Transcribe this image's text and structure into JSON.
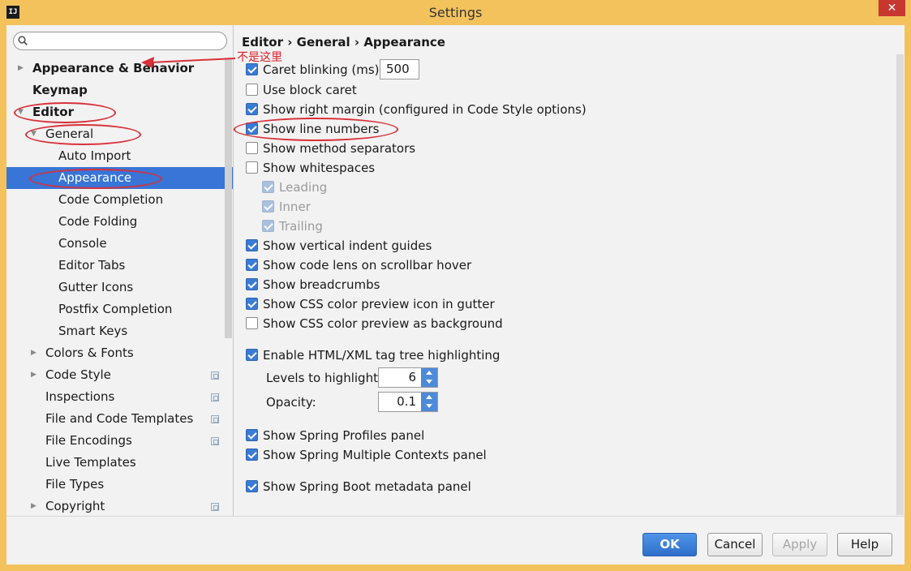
{
  "window": {
    "title": "Settings",
    "app_icon": "IJ",
    "close_label": "✕"
  },
  "search": {
    "placeholder": ""
  },
  "tree": [
    {
      "label": "Appearance & Behavior",
      "bold": true,
      "arrow": "right"
    },
    {
      "label": "Keymap",
      "bold": true
    },
    {
      "label": "Editor",
      "bold": true,
      "arrow": "down"
    },
    {
      "label": "General",
      "arrow": "down"
    },
    {
      "label": "Auto Import"
    },
    {
      "label": "Appearance",
      "selected": true
    },
    {
      "label": "Code Completion"
    },
    {
      "label": "Code Folding"
    },
    {
      "label": "Console"
    },
    {
      "label": "Editor Tabs"
    },
    {
      "label": "Gutter Icons"
    },
    {
      "label": "Postfix Completion"
    },
    {
      "label": "Smart Keys"
    },
    {
      "label": "Colors & Fonts",
      "arrow": "right"
    },
    {
      "label": "Code Style",
      "arrow": "right",
      "copy": true
    },
    {
      "label": "Inspections",
      "copy": true
    },
    {
      "label": "File and Code Templates",
      "copy": true
    },
    {
      "label": "File Encodings",
      "copy": true
    },
    {
      "label": "Live Templates"
    },
    {
      "label": "File Types"
    },
    {
      "label": "Copyright",
      "arrow": "right",
      "copy": true
    }
  ],
  "breadcrumb": {
    "part1": "Editor",
    "sep": "›",
    "part2": "General",
    "part3": "Appearance"
  },
  "options": {
    "caret_blinking": {
      "label": "Caret blinking (ms):",
      "checked": true,
      "value": "500"
    },
    "block_caret": {
      "label": "Use block caret",
      "checked": false
    },
    "right_margin": {
      "label": "Show right margin (configured in Code Style options)",
      "checked": true
    },
    "line_numbers": {
      "label": "Show line numbers",
      "checked": true
    },
    "method_separators": {
      "label": "Show method separators",
      "checked": false
    },
    "whitespaces": {
      "label": "Show whitespaces",
      "checked": false
    },
    "leading": {
      "label": "Leading",
      "checked": true,
      "disabled": true
    },
    "inner": {
      "label": "Inner",
      "checked": true,
      "disabled": true
    },
    "trailing": {
      "label": "Trailing",
      "checked": true,
      "disabled": true
    },
    "indent_guides": {
      "label": "Show vertical indent guides",
      "checked": true
    },
    "code_lens": {
      "label": "Show code lens on scrollbar hover",
      "checked": true
    },
    "breadcrumbs": {
      "label": "Show breadcrumbs",
      "checked": true
    },
    "css_icon": {
      "label": "Show CSS color preview icon in gutter",
      "checked": true
    },
    "css_bg": {
      "label": "Show CSS color preview as background",
      "checked": false
    },
    "tag_tree": {
      "label": "Enable HTML/XML tag tree highlighting",
      "checked": true
    },
    "levels": {
      "label": "Levels to highlight:",
      "value": "6"
    },
    "opacity": {
      "label": "Opacity:",
      "value": "0.1"
    },
    "spring_profiles": {
      "label": "Show Spring Profiles panel",
      "checked": true
    },
    "spring_contexts": {
      "label": "Show Spring Multiple Contexts panel",
      "checked": true
    },
    "spring_boot": {
      "label": "Show Spring Boot metadata panel",
      "checked": true
    }
  },
  "footer": {
    "ok": "OK",
    "cancel": "Cancel",
    "apply": "Apply",
    "help": "Help"
  },
  "annotation": {
    "note": "不是这里"
  },
  "colors": {
    "selection": "#3875d7",
    "annotation": "#d9303a",
    "title_bar": "#f3c25d"
  }
}
